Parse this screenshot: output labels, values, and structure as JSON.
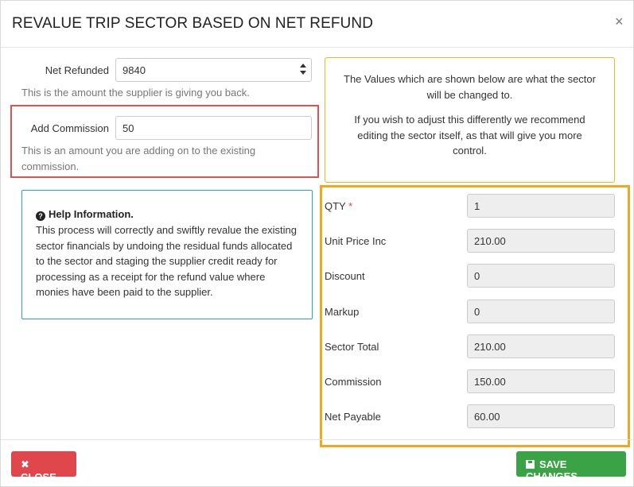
{
  "modal": {
    "title": "REVALUE TRIP SECTOR BASED ON NET REFUND",
    "close_icon": "×"
  },
  "net_refunded": {
    "label": "Net Refunded",
    "value": "9840",
    "help": "This is the amount the supplier is giving you back."
  },
  "add_commission": {
    "label": "Add Commission",
    "value": "50",
    "help": "This is an amount you are adding on to the existing commission."
  },
  "help_info": {
    "icon": "question-circle-icon",
    "title": "Help Information.",
    "text": "This process will correctly and swiftly revalue the existing sector financials by undoing the residual funds allocated to the sector and staging the supplier credit ready for processing as a receipt for the refund value where monies have been paid to the supplier."
  },
  "notice": {
    "p1": "The Values which are shown below are what the sector will be changed to.",
    "p2": "If you wish to adjust this differently we recommend editing the sector itself, as that will give you more control."
  },
  "fields": {
    "qty": {
      "label": "QTY",
      "required": "*",
      "value": "1"
    },
    "unit_price": {
      "label": "Unit Price Inc",
      "value": "210.00"
    },
    "discount": {
      "label": "Discount",
      "value": "0"
    },
    "markup": {
      "label": "Markup",
      "value": "0"
    },
    "sector_total": {
      "label": "Sector Total",
      "value": "210.00"
    },
    "commission": {
      "label": "Commission",
      "value": "150.00"
    },
    "net_payable": {
      "label": "Net Payable",
      "value": "60.00"
    }
  },
  "footer": {
    "close_label": "CLOSE",
    "close_icon": "times-icon",
    "save_label": "SAVE CHANGES",
    "save_icon": "floppy-disk-icon"
  },
  "colors": {
    "close_button": "#e0474c",
    "save_button": "#3aa346",
    "highlight_red": "#e05252",
    "highlight_orange": "#f0a81c",
    "help_border": "#2aa7a7",
    "notice_border": "#f0b429"
  }
}
